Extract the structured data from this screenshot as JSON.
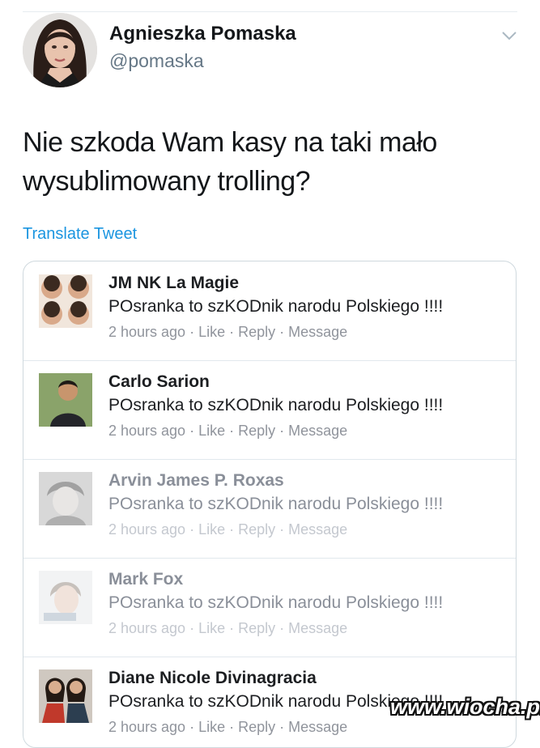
{
  "author": {
    "name": "Agnieszka Pomaska",
    "handle": "@pomaska"
  },
  "tweet": {
    "text_line1": "Nie szkoda Wam kasy na taki mało",
    "text_line2": "wysublimowany trolling?",
    "translate_label": "Translate Tweet"
  },
  "comments": [
    {
      "name": "JM NK La Magie",
      "text": "POsranka to szKODnik narodu Polskiego !!!!",
      "time": "2 hours ago",
      "like": "Like",
      "reply": "Reply",
      "message": "Message"
    },
    {
      "name": "Carlo Sarion",
      "text": "POsranka to szKODnik narodu Polskiego !!!!",
      "time": "2 hours ago",
      "like": "Like",
      "reply": "Reply",
      "message": "Message"
    },
    {
      "name": "Arvin James P. Roxas",
      "text": "POsranka to szKODnik narodu Polskiego !!!!",
      "time": "2 hours ago",
      "like": "Like",
      "reply": "Reply",
      "message": "Message"
    },
    {
      "name": "Mark Fox",
      "text": "POsranka to szKODnik narodu Polskiego !!!!",
      "time": "2 hours ago",
      "like": "Like",
      "reply": "Reply",
      "message": "Message"
    },
    {
      "name": "Diane Nicole Divinagracia",
      "text": "POsranka to szKODnik narodu Polskiego !!!!",
      "time": "2 hours ago",
      "like": "Like",
      "reply": "Reply",
      "message": "Message"
    }
  ],
  "meta_separator": "·",
  "watermark": "www.wiocha.pl",
  "icons": {
    "menu": "chevron-down-icon"
  },
  "colors": {
    "link": "#1b95e0",
    "handle": "#657786",
    "meta": "#90949c"
  }
}
